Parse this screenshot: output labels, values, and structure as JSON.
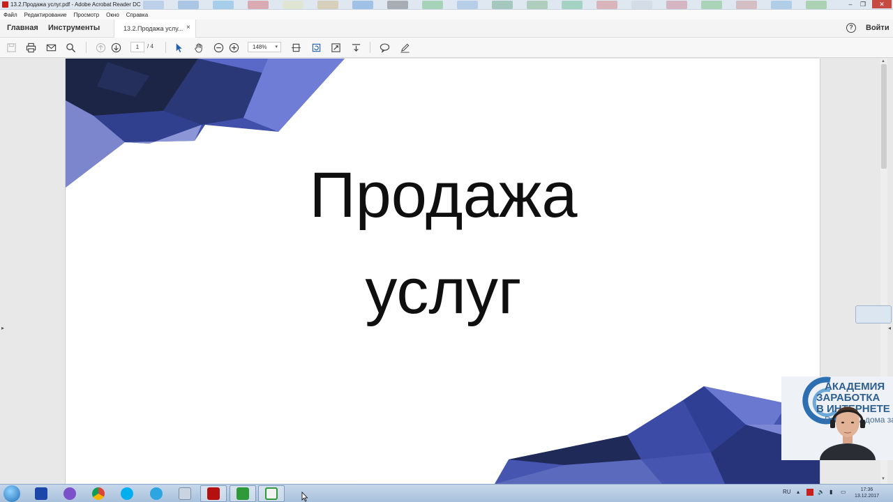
{
  "window": {
    "title": "13.2.Продажа услуг.pdf - Adobe Acrobat Reader DC",
    "controls": [
      "–",
      "❐",
      "✕"
    ]
  },
  "menu": [
    "Файл",
    "Редактирование",
    "Просмотр",
    "Окно",
    "Справка"
  ],
  "nav": {
    "home_label": "Главная",
    "tools_label": "Инструменты",
    "doc_tab_label": "13.2.Продажа услу...",
    "doc_tab_close": "×",
    "help_label": "?",
    "signin_label": "Войти"
  },
  "toolbar": {
    "current_page": "1",
    "total_pages": "/ 4",
    "zoom": "148%",
    "zoom_caret": "▾"
  },
  "document": {
    "title_line1": "Продажа",
    "title_line2": "услуг"
  },
  "webcam": {
    "brand_line1": "АКАДЕМИЯ",
    "brand_line2": "ЗАРАБОТКА",
    "brand_line3": "В ИНТЕРНЕТЕ",
    "brand_line4": "Работаем дома за"
  },
  "taskbar": {
    "language": "RU",
    "time": "17:36",
    "date": "13.12.2017",
    "apps": [
      "save-app",
      "viber",
      "chrome",
      "skype",
      "telegram",
      "calculator",
      "acrobat",
      "camtasia-recorder",
      "camtasia-editor"
    ]
  },
  "colors": {
    "accent_blue": "#3f4fae",
    "acrobat_red": "#c8201d",
    "taskbar": "#b5cbe4"
  }
}
